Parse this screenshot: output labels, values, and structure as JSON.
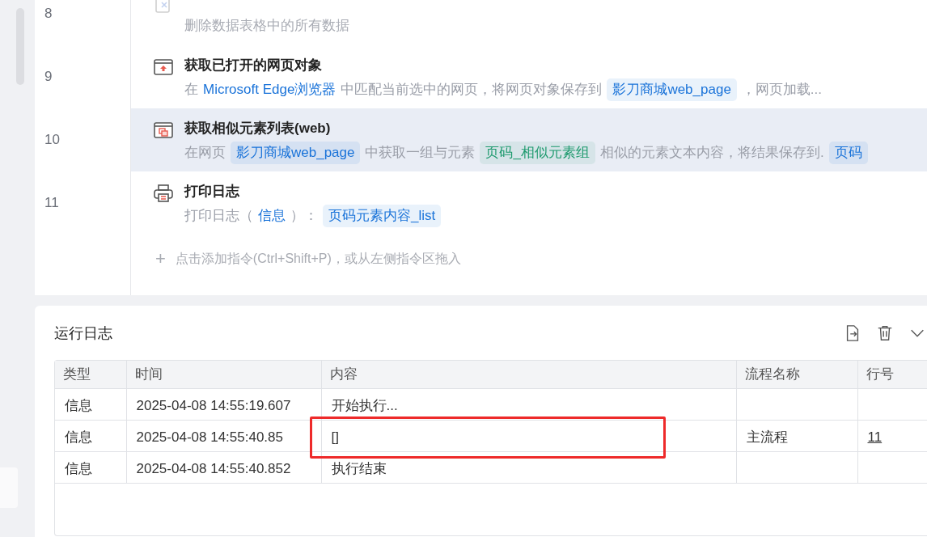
{
  "steps": [
    {
      "number": "8",
      "kind": "table-clear",
      "disabled": true,
      "selected": false,
      "description": [
        {
          "kind": "text",
          "text": "删除数据表格中的所有数据"
        }
      ]
    },
    {
      "number": "9",
      "kind": "browser-up",
      "title": "获取已打开的网页对象",
      "disabled": false,
      "selected": false,
      "description": [
        {
          "kind": "text",
          "text": "在"
        },
        {
          "kind": "link",
          "text": "Microsoft Edge浏览器"
        },
        {
          "kind": "text",
          "text": "中匹配当前选中的网页，将网页对象保存到"
        },
        {
          "kind": "chip",
          "text": "影刀商城web_page",
          "color": "#1a73d9"
        },
        {
          "kind": "text",
          "text": "，网页加载..."
        }
      ]
    },
    {
      "number": "10",
      "kind": "browser-copy",
      "title": "获取相似元素列表(web)",
      "disabled": false,
      "selected": true,
      "description": [
        {
          "kind": "text",
          "text": "在网页"
        },
        {
          "kind": "chip",
          "text": "影刀商城web_page",
          "color": "#1a73d9"
        },
        {
          "kind": "text",
          "text": "中获取一组与元素"
        },
        {
          "kind": "chip",
          "text": "页码_相似元素组",
          "color": "#1e9a6e"
        },
        {
          "kind": "text",
          "text": "相似的元素文本内容，将结果保存到."
        },
        {
          "kind": "chip",
          "text": "页码",
          "color": "#1a73d9"
        }
      ]
    },
    {
      "number": "11",
      "kind": "printer",
      "title": "打印日志",
      "disabled": false,
      "selected": false,
      "description": [
        {
          "kind": "text",
          "text": "打印日志（"
        },
        {
          "kind": "link",
          "text": "信息"
        },
        {
          "kind": "text",
          "text": "）："
        },
        {
          "kind": "chip",
          "text": "页码元素内容_list",
          "color": "#1a73d9"
        }
      ]
    }
  ],
  "add_hint": {
    "icon": "+",
    "text": "点击添加指令(Ctrl+Shift+P)，或从左侧指令区拖入"
  },
  "log": {
    "title": "运行日志",
    "table": {
      "columns": [
        "类型",
        "时间",
        "内容",
        "流程名称",
        "行号"
      ],
      "rows": [
        {
          "cells": [
            "信息",
            "2025-04-08 14:55:19.607",
            "开始执行...",
            "",
            ""
          ]
        },
        {
          "cells": [
            "信息",
            "2025-04-08 14:55:40.85",
            "[]",
            "主流程",
            "11"
          ]
        },
        {
          "cells": [
            "信息",
            "2025-04-08 14:55:40.852",
            "执行结束",
            "",
            ""
          ]
        }
      ]
    }
  }
}
